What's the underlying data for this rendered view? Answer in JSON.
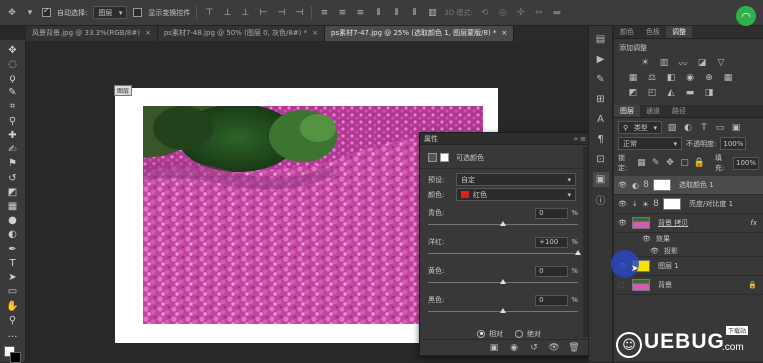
{
  "optbar": {
    "auto_select_label": "自动选择:",
    "auto_select_value": "图层",
    "show_transform_label": "显示变换控件",
    "mode_3d": "3D 模式:"
  },
  "tabs": [
    {
      "label": "风景背景.jpg @ 33.3%(RGB/8#)",
      "close": "×"
    },
    {
      "label": "ps素材7-48.jpg @ 50% (图层 0, 灰色/8#) *",
      "close": "×"
    },
    {
      "label": "ps素材7-47.jpg @ 25% (选取颜色 1, 图层蒙版/8) *",
      "close": "×"
    }
  ],
  "doc_label": "图层",
  "properties": {
    "title": "属性",
    "subtitle": "可选颜色",
    "preset_label": "预设:",
    "preset_value": "自定",
    "colors_label": "颜色:",
    "colors_value": "红色",
    "colors_swatch": "#e02020",
    "rows": [
      {
        "label": "青色:",
        "value": "0",
        "unit": "%",
        "position": 0.5
      },
      {
        "label": "洋红:",
        "value": "+100",
        "unit": "%",
        "position": 1.0
      },
      {
        "label": "黄色:",
        "value": "0",
        "unit": "%",
        "position": 0.5
      },
      {
        "label": "黑色:",
        "value": "0",
        "unit": "%",
        "position": 0.5
      }
    ],
    "relative_label": "相对",
    "absolute_label": "绝对"
  },
  "right_panel": {
    "top_tabs": [
      "颜色",
      "色板",
      "调整"
    ],
    "add_adjust_label": "添加调整",
    "layer_tabs": [
      "图层",
      "通道",
      "路径"
    ],
    "filter_kind": "类型",
    "blend_mode": "正常",
    "opacity_label": "不透明度:",
    "opacity_value": "100%",
    "lock_label": "锁定:",
    "fill_label": "填充:",
    "fill_value": "100%",
    "layers": [
      {
        "name": "选取颜色 1",
        "type": "adjustment"
      },
      {
        "name": "亮度/对比度 1",
        "type": "adjustment"
      },
      {
        "name": "背景 拷贝",
        "type": "image",
        "fx": "fx"
      },
      {
        "name": "效果",
        "type": "effect"
      },
      {
        "name": "投影",
        "type": "effect"
      },
      {
        "name": "图层 1",
        "type": "fill"
      },
      {
        "name": "背景",
        "type": "image"
      }
    ]
  },
  "watermark": {
    "text": "UEBUG",
    "suffix": ".com",
    "badge": "下载站"
  }
}
